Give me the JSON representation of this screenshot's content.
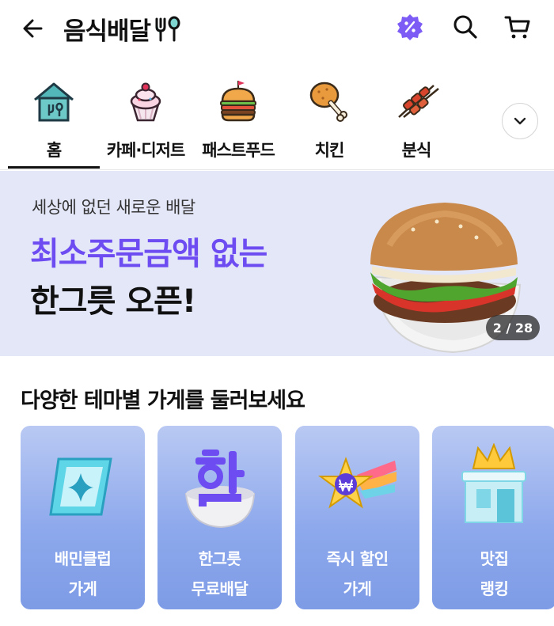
{
  "header": {
    "title": "음식배달",
    "accent": "#7c5cf5"
  },
  "categories": [
    {
      "label": "홈",
      "icon": "home-icon",
      "selected": true
    },
    {
      "label": "카페·디저트",
      "icon": "cake-icon"
    },
    {
      "label": "패스트푸드",
      "icon": "burger-icon"
    },
    {
      "label": "치킨",
      "icon": "chicken-leg-icon"
    },
    {
      "label": "분식",
      "icon": "tteok-skewer-icon"
    }
  ],
  "banner": {
    "subtitle": "세상에 없던 새로운 배달",
    "headline": "최소주문금액 없는",
    "title": "한그릇 오픈!",
    "pager": "2 / 28",
    "background": "#e4e7f8",
    "headline_color": "#6d4df2"
  },
  "themes": {
    "title": "다양한 테마별 가게를 둘러보세요",
    "cards": [
      {
        "line1": "배민클럽",
        "line2": "가게",
        "icon": "club-badge-icon"
      },
      {
        "line1": "한그릇",
        "line2": "무료배달",
        "icon": "bowl-han-icon"
      },
      {
        "line1": "즉시 할인",
        "line2": "가게",
        "icon": "won-star-icon"
      },
      {
        "line1": "맛집",
        "line2": "랭킹",
        "icon": "crown-store-icon"
      }
    ]
  }
}
